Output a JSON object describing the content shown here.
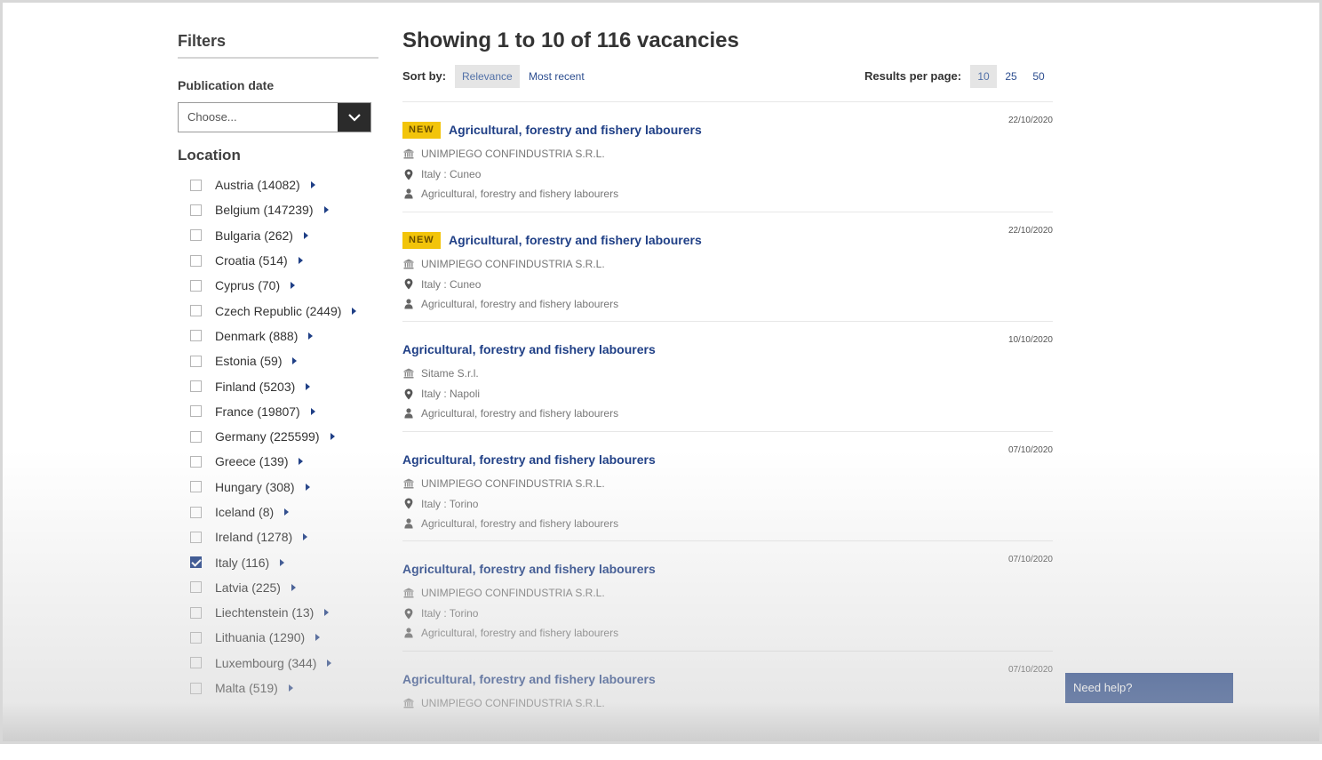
{
  "sidebar": {
    "filters_title": "Filters",
    "publication_date_label": "Publication date",
    "publication_select_value": "Choose...",
    "location_title": "Location",
    "locations": [
      {
        "label": "Austria (14082)",
        "checked": false
      },
      {
        "label": "Belgium (147239)",
        "checked": false
      },
      {
        "label": "Bulgaria (262)",
        "checked": false
      },
      {
        "label": "Croatia (514)",
        "checked": false
      },
      {
        "label": "Cyprus (70)",
        "checked": false
      },
      {
        "label": "Czech Republic (2449)",
        "checked": false
      },
      {
        "label": "Denmark (888)",
        "checked": false
      },
      {
        "label": "Estonia (59)",
        "checked": false
      },
      {
        "label": "Finland (5203)",
        "checked": false
      },
      {
        "label": "France (19807)",
        "checked": false
      },
      {
        "label": "Germany (225599)",
        "checked": false
      },
      {
        "label": "Greece (139)",
        "checked": false
      },
      {
        "label": "Hungary (308)",
        "checked": false
      },
      {
        "label": "Iceland (8)",
        "checked": false
      },
      {
        "label": "Ireland (1278)",
        "checked": false
      },
      {
        "label": "Italy (116)",
        "checked": true
      },
      {
        "label": "Latvia (225)",
        "checked": false
      },
      {
        "label": "Liechtenstein (13)",
        "checked": false
      },
      {
        "label": "Lithuania (1290)",
        "checked": false
      },
      {
        "label": "Luxembourg (344)",
        "checked": false
      },
      {
        "label": "Malta (519)",
        "checked": false
      }
    ]
  },
  "main": {
    "heading": "Showing 1 to 10 of 116 vacancies",
    "sort_label": "Sort by:",
    "sort_options": [
      {
        "label": "Relevance",
        "active": true
      },
      {
        "label": "Most recent",
        "active": false
      }
    ],
    "rpp_label": "Results per page:",
    "rpp_options": [
      {
        "label": "10",
        "active": true
      },
      {
        "label": "25",
        "active": false
      },
      {
        "label": "50",
        "active": false
      }
    ]
  },
  "results": [
    {
      "new": true,
      "badge": "NEW",
      "title": "Agricultural, forestry and fishery labourers",
      "date": "22/10/2020",
      "employer": "UNIMPIEGO CONFINDUSTRIA S.R.L.",
      "location": "Italy : Cuneo",
      "occupation": "Agricultural, forestry and fishery labourers"
    },
    {
      "new": true,
      "badge": "NEW",
      "title": "Agricultural, forestry and fishery labourers",
      "date": "22/10/2020",
      "employer": "UNIMPIEGO CONFINDUSTRIA S.R.L.",
      "location": "Italy : Cuneo",
      "occupation": "Agricultural, forestry and fishery labourers"
    },
    {
      "new": false,
      "badge": "",
      "title": "Agricultural, forestry and fishery labourers",
      "date": "10/10/2020",
      "employer": "Sitame S.r.l.",
      "location": "Italy : Napoli",
      "occupation": "Agricultural, forestry and fishery labourers"
    },
    {
      "new": false,
      "badge": "",
      "title": "Agricultural, forestry and fishery labourers",
      "date": "07/10/2020",
      "employer": "UNIMPIEGO CONFINDUSTRIA S.R.L.",
      "location": "Italy : Torino",
      "occupation": "Agricultural, forestry and fishery labourers"
    },
    {
      "new": false,
      "badge": "",
      "title": "Agricultural, forestry and fishery labourers",
      "date": "07/10/2020",
      "employer": "UNIMPIEGO CONFINDUSTRIA S.R.L.",
      "location": "Italy : Torino",
      "occupation": "Agricultural, forestry and fishery labourers"
    },
    {
      "new": false,
      "badge": "",
      "title": "Agricultural, forestry and fishery labourers",
      "date": "07/10/2020",
      "employer": "UNIMPIEGO CONFINDUSTRIA S.R.L.",
      "location": "",
      "occupation": ""
    }
  ],
  "help_button": "Need help?",
  "colors": {
    "accent": "#1f3f86",
    "badge": "#f2c40a",
    "help_bg": "#1c3f86"
  },
  "icons": {
    "employer": "institution-icon",
    "location": "map-marker-icon",
    "occupation": "user-icon",
    "select": "chevron-down-icon",
    "expand": "caret-right-icon"
  }
}
